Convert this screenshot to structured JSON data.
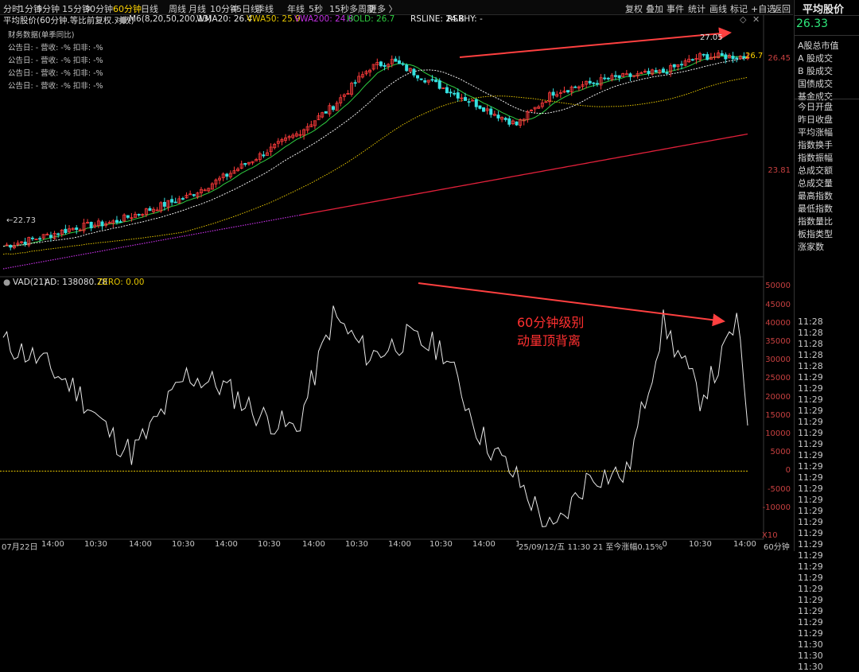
{
  "toolbar": {
    "timeframes": [
      "分时",
      "1分钟",
      "5分钟",
      "15分钟",
      "30分钟",
      "60分钟",
      "日线",
      "周线",
      "月线",
      "10分钟",
      "45日线",
      "季线",
      "年线",
      "5秒",
      "15秒",
      "多周期",
      "更多 〉"
    ],
    "active_timeframe": "60分钟",
    "actions": [
      "复权",
      "叠加",
      "事件",
      "统计",
      "画线",
      "标记",
      "+自选",
      "返回"
    ]
  },
  "legend": {
    "name": "平均股价(60分钟.等比前复权.对数)",
    "m6": "M6(8,20,50,200,13)",
    "wma20": "WMA20: 26.4",
    "vwa50": "VWA50: 25.9",
    "vwa200": "VWA200: 24.8",
    "hold": "HOLD: 26.7",
    "rsline": "RSLINE: 24.8",
    "rsrhy": "RSRHY: -",
    "gear_icon": "gear-icon",
    "close_icon": "close-icon"
  },
  "financial": {
    "title": "财务数据(单季同比)",
    "rows": [
      "公告日: -   营收: -%   扣非: -%",
      "公告日: -   营收: -%   扣非: -%",
      "公告日: -   营收: -%   扣非: -%",
      "公告日: -   营收: -%   扣非: -%"
    ]
  },
  "price_axis": {
    "ticks": [
      "26.45",
      "23.81"
    ],
    "current_label": "26.7",
    "high_label": "27.05",
    "low_label": "22.73"
  },
  "vad": {
    "label": "VAD(21)",
    "ad": "AD: 138080.78",
    "zero": "ZERO: 0.00",
    "ticks": [
      "50000",
      "45000",
      "40000",
      "35000",
      "30000",
      "25000",
      "20000",
      "15000",
      "10000",
      "5000",
      "0",
      "-5000",
      "-10000"
    ],
    "scale_label": "X10"
  },
  "annotation": {
    "line1": "60分钟级别",
    "line2": "动量顶背离"
  },
  "x_axis": {
    "labels": [
      "07月22日",
      "14:00",
      "10:30",
      "14:00",
      "10:30",
      "14:00",
      "10:30",
      "14:00",
      "10:30",
      "14:00",
      "10:30",
      "14:00",
      "10:30",
      "14:00",
      "10:30",
      "14:00",
      "10:30",
      "14:00"
    ],
    "status": "25/09/12/五 11:30 21 至今涨幅0.15%",
    "period": "60分钟"
  },
  "panel": {
    "title": "平均股价",
    "price": "26.33",
    "items": [
      "A股总市值",
      "A 股成交",
      "B 股成交",
      "国债成交",
      "基金成交",
      "今日开盘",
      "昨日收盘",
      "平均涨幅",
      "指数换手",
      "指数振幅",
      "总成交额",
      "总成交量",
      "最高指数",
      "最低指数",
      "指数量比",
      "板指类型",
      "涨家数"
    ],
    "times": [
      "11:28",
      "11:28",
      "11:28",
      "11:28",
      "11:28",
      "11:29",
      "11:29",
      "11:29",
      "11:29",
      "11:29",
      "11:29",
      "11:29",
      "11:29",
      "11:29",
      "11:29",
      "11:29",
      "11:29",
      "11:29",
      "11:29",
      "11:29",
      "11:29",
      "11:29",
      "11:29",
      "11:29",
      "11:29",
      "11:29",
      "11:29",
      "11:29",
      "11:29",
      "11:30",
      "11:30",
      "11:30"
    ]
  },
  "chart_data": [
    {
      "type": "line",
      "title": "",
      "series": [
        {
          "name": "平均股价",
          "x": [
            0,
            10,
            20,
            30,
            40,
            50,
            60,
            70,
            80,
            90,
            100,
            106,
            115,
            125,
            140,
            150,
            165,
            180,
            190,
            203
          ],
          "values": [
            22.73,
            22.9,
            23.1,
            23.2,
            23.45,
            23.7,
            24.1,
            24.55,
            25.0,
            25.6,
            26.45,
            26.6,
            26.2,
            25.8,
            25.2,
            25.9,
            26.2,
            26.35,
            26.7,
            26.7
          ]
        }
      ],
      "high": 27.05,
      "low": 22.73,
      "last": 26.7
    },
    {
      "type": "line",
      "title": "",
      "series": [
        {
          "name": "VAD(21)",
          "x": [
            0,
            10,
            20,
            30,
            35,
            40,
            50,
            60,
            70,
            80,
            90,
            100,
            110,
            120,
            130,
            140,
            150,
            160,
            170,
            180,
            190,
            195,
            200,
            203
          ],
          "values": [
            35000,
            30000,
            22000,
            9000,
            5000,
            11000,
            26000,
            23000,
            15000,
            11000,
            42000,
            31000,
            36000,
            33000,
            10000,
            -2000,
            -17000,
            -1000,
            -1000,
            40000,
            20000,
            28000,
            41000,
            14000
          ]
        }
      ],
      "ylim": [
        -18000,
        52000
      ],
      "zero": 0
    }
  ]
}
